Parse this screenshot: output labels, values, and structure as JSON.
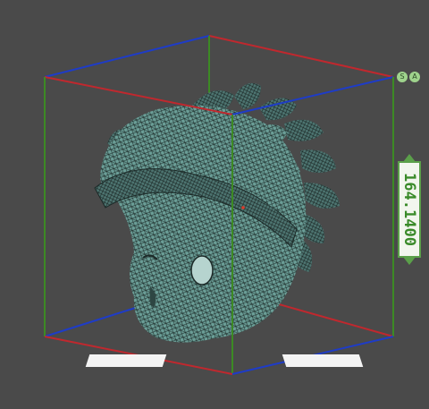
{
  "viewport": {
    "background": "#4a4a4a",
    "model_color": "#6b9e97",
    "axis_colors": {
      "x": "#c0282e",
      "y": "#1e3cc8",
      "z": "#3c8a24"
    }
  },
  "corner_badges": [
    "S",
    "A"
  ],
  "dimensions": {
    "x_label": "",
    "y_label": "",
    "z_label": "164.1400"
  }
}
